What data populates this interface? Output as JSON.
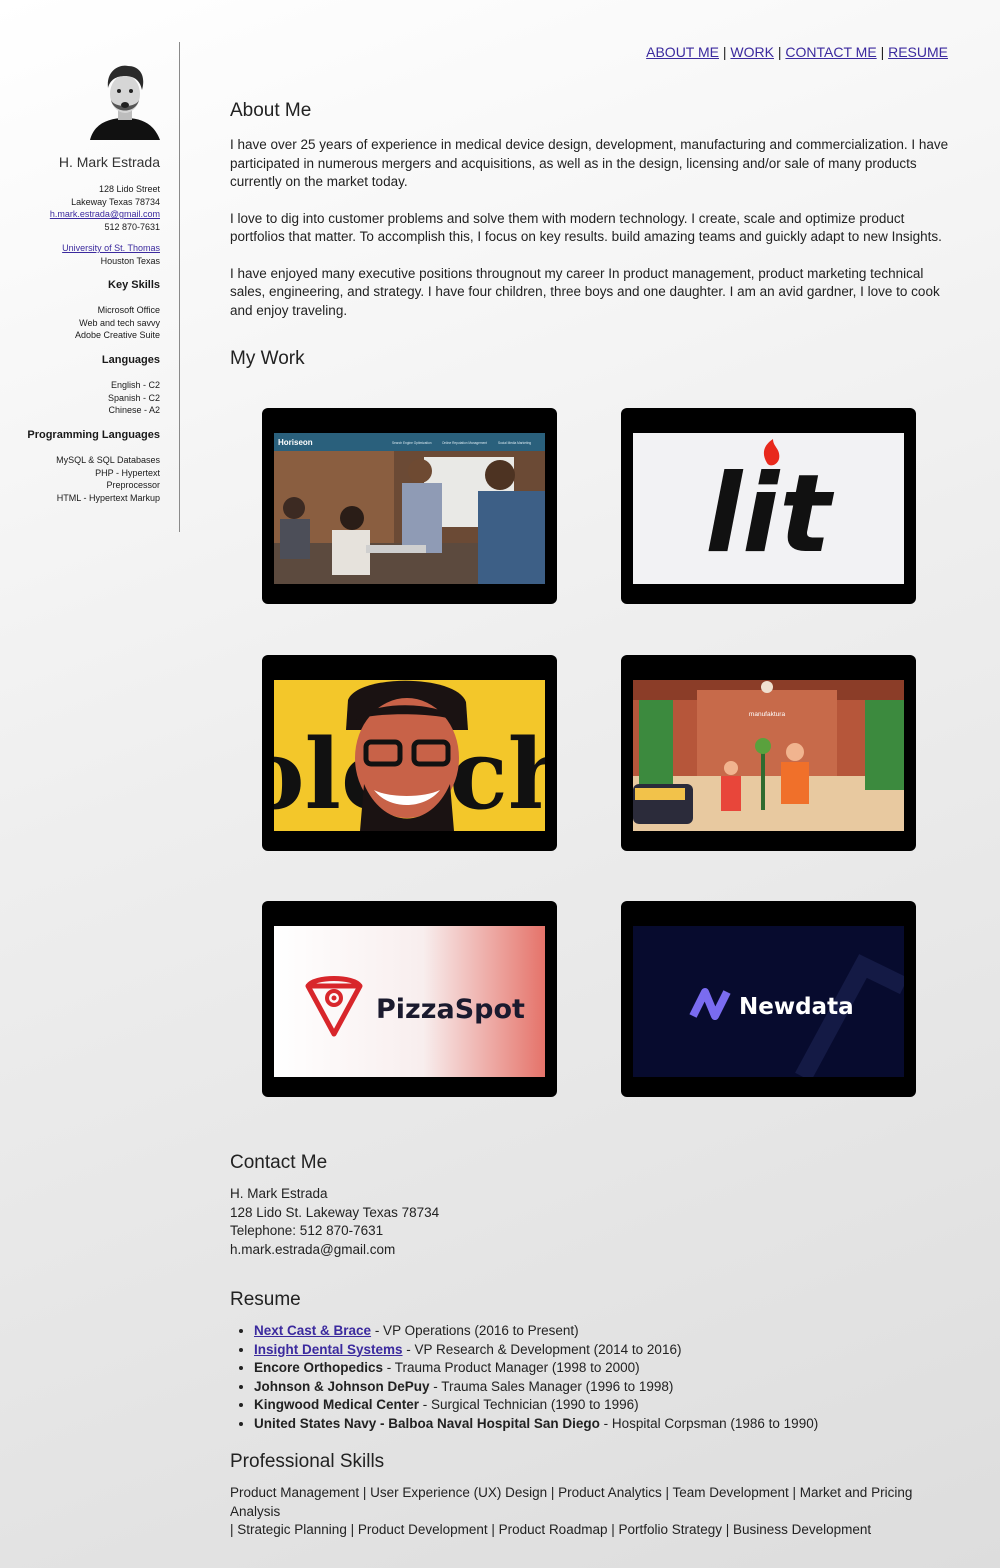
{
  "nav": {
    "items": [
      "ABOUT ME",
      "WORK",
      "CONTACT ME",
      "RESUME"
    ],
    "separator": "|"
  },
  "sidebar": {
    "name": "H. Mark Estrada",
    "address": [
      "128 Lido Street",
      "Lakeway Texas 78734"
    ],
    "email": "h.mark.estrada@gmail.com",
    "phone": "512 870-7631",
    "school": "University of St. Thomas",
    "school_location": "Houston Texas",
    "key_skills_heading": "Key Skills",
    "key_skills": [
      "Microsoft Office",
      "Web and tech savvy",
      "Adobe Creative Suite"
    ],
    "languages_heading": "Languages",
    "languages": [
      "English - C2",
      "Spanish - C2",
      "Chinese - A2"
    ],
    "programming_heading": "Programming Languages",
    "programming": [
      "MySQL & SQL Databases",
      "PHP - Hypertext",
      "Preprocessor",
      "HTML - Hypertext Markup"
    ]
  },
  "about": {
    "heading": "About Me",
    "paragraphs": [
      "I have over 25 years of experience in medical device design, development, manufacturing and commercialization. I have participated in numerous mergers and acquisitions, as well as in the design, licensing and/or sale of many products currently on the market today.",
      "I love to dig into customer problems and solve them with modern technology. I create, scale and optimize product portfolios that matter. To accomplish this, I focus on key results. build amazing teams and guickly adapt to new Insights.",
      "I have enjoyed many executive positions througnout my career In product management, product marketing technical sales, engineering, and strategy. I have four children, three boys and one daughter. I am an avid gardner, I love to cook and enjoy traveling."
    ]
  },
  "work": {
    "heading": "My Work",
    "tiles": {
      "horiseon": {
        "logo": "Horiseon",
        "links": [
          "Search Engine Optimization",
          "Online Reputation Management",
          "Social Media Marketing"
        ]
      },
      "lit": {
        "logo": "lit",
        "accent": "#e8291c"
      },
      "portrait": {
        "text": "olotch"
      },
      "manufaktura": {
        "label": "manufaktura"
      },
      "pizzaspot": {
        "logo": "PizzaSpot",
        "accent": "#d8262b"
      },
      "newdata": {
        "logo": "Newdata",
        "background": "#070b2e"
      }
    }
  },
  "contact": {
    "heading": "Contact Me",
    "lines": [
      "H. Mark Estrada",
      "128 Lido St. Lakeway Texas 78734",
      "Telephone: 512 870-7631",
      "h.mark.estrada@gmail.com"
    ]
  },
  "resume": {
    "heading": "Resume",
    "items": [
      {
        "company": "Next Cast & Brace",
        "detail": " - VP Operations (2016 to Present)"
      },
      {
        "company": "Insight Dental Systems",
        "detail": " - VP Research & Development (2014 to 2016)"
      },
      {
        "company": "Encore Orthopedics",
        "detail": " - Trauma Product Manager (1998 to 2000)"
      },
      {
        "company": "Johnson & Johnson DePuy",
        "detail": " - Trauma Sales Manager (1996 to 1998)"
      },
      {
        "company": "Kingwood Medical Center",
        "detail": " - Surgical Technician (1990 to 1996)"
      },
      {
        "company": "United States Navy - Balboa Naval Hospital San Diego",
        "detail": " - Hospital Corpsman (1986 to 1990)"
      }
    ]
  },
  "skills": {
    "heading": "Professional Skills",
    "line1": "Product Management | User Experience (UX) Design | Product Analytics | Team Development | Market and Pricing Analysis",
    "line2": "| Strategic Planning | Product Development | Product Roadmap | Portfolio Strategy | Business Development"
  }
}
